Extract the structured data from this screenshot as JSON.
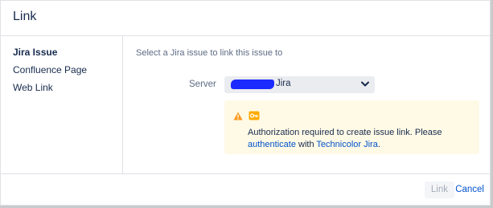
{
  "dialog": {
    "title": "Link"
  },
  "nav": {
    "items": [
      {
        "label": "Jira Issue",
        "active": true
      },
      {
        "label": "Confluence Page",
        "active": false
      },
      {
        "label": "Web Link",
        "active": false
      }
    ]
  },
  "form": {
    "instructions": "Select a Jira issue to link this issue to",
    "server_label": "Server",
    "server_value_suffix": "Jira"
  },
  "warning": {
    "icon": "warning-icon",
    "secondary_icon": "key-icon",
    "text_before": "Authorization required to create issue link. Please",
    "link_authenticate": "authenticate",
    "text_mid": "with",
    "link_server": "Technicolor Jira",
    "text_end": "."
  },
  "footer": {
    "link_button": "Link",
    "cancel_button": "Cancel"
  },
  "colors": {
    "accent": "#0052cc",
    "warning_bg": "#fffae6",
    "warning_icon": "#ff991f",
    "redaction": "#1b2bff"
  }
}
